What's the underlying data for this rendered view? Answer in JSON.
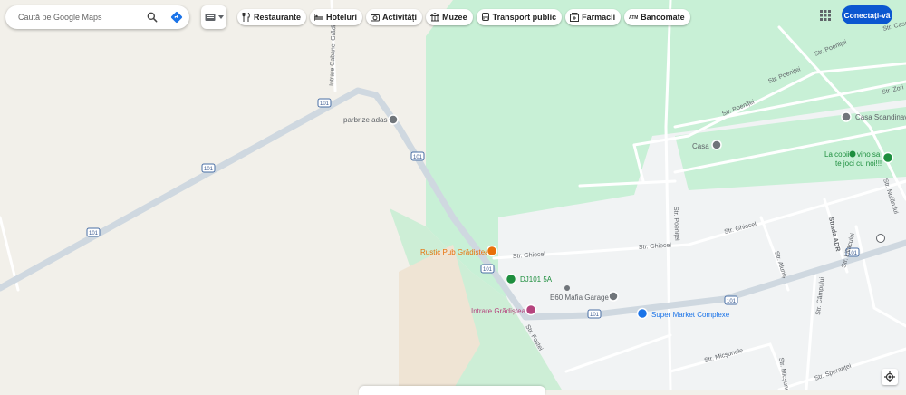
{
  "search": {
    "placeholder": "Caută pe Google Maps"
  },
  "chips": [
    {
      "label": "Restaurante",
      "icon": "fork-knife-icon"
    },
    {
      "label": "Hoteluri",
      "icon": "bed-icon"
    },
    {
      "label": "Activități",
      "icon": "camera-icon"
    },
    {
      "label": "Muzee",
      "icon": "museum-icon"
    },
    {
      "label": "Transport public",
      "icon": "bus-icon"
    },
    {
      "label": "Farmacii",
      "icon": "pharmacy-icon"
    },
    {
      "label": "Bancomate",
      "icon": "atm-icon"
    }
  ],
  "header": {
    "signin_label": "Conectați-vă"
  },
  "map": {
    "road_shield": "101",
    "route_label": "DJ101 5A",
    "places": {
      "parbrize": "parbrize adas",
      "casa_scandinava": "Casa Scandinava",
      "casa": "Casa",
      "la_copii_line1": "La copii",
      "la_copii_line2": "vino sa",
      "la_copii_line3": "te joci cu noi!!!",
      "rustic_pub": "Rustic Pub Grădiștea",
      "mafia_garage": "E60 Mafia Garage",
      "intrare_gradistea": "Intrare Grădiștea",
      "super_market": "Super Market Complexe"
    },
    "streets": {
      "intrare_cabanei": "Intrare Cabanei Grădiștea",
      "poenitei_1": "Str. Poeniței",
      "poenitei_2": "Str. Poeniței",
      "poenitei_3": "Str. Poeniței",
      "poenitei_v": "Str. Poeniței",
      "zorilor": "Str. Zori",
      "ghiocel_1": "Str. Ghiocel",
      "ghiocel_2": "Str. Ghiocel",
      "ghiocel_3": "Str. Ghiocel",
      "nufarului": "Str. Nufărului",
      "strada_adr": "Strada ADR",
      "liliacului": "Str. Liliacului",
      "alunis": "Str. Aluniș",
      "campului": "Str. Câmpului",
      "fostei": "Str. Fostei",
      "micsunele_1": "Str. Micșunele",
      "micsunele_2": "Str. Micșunele",
      "sperantei": "Str. Speranței",
      "cascadei": "Str. Cascadei"
    }
  },
  "colors": {
    "land": "#f2f0ea",
    "forest": "#c8f0d6",
    "built": "#f1f3f4",
    "highway": "#cfd8e0",
    "road": "#ffffff",
    "accent": "#0b57d0",
    "food": "#e8710a",
    "park": "#1e8e3e",
    "poi_grey": "#70757a",
    "shop": "#1a73e8",
    "shop_label": "#1a73e8",
    "poi_pink": "#b5447e"
  }
}
